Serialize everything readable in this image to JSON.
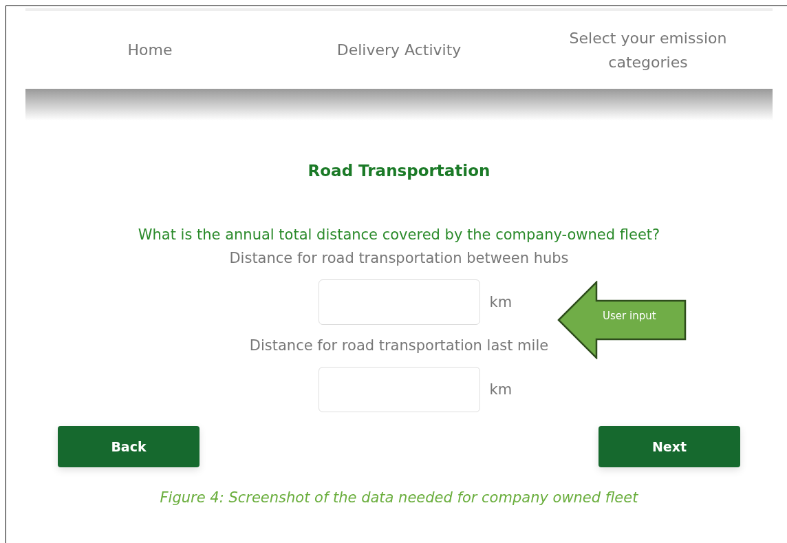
{
  "nav": {
    "items": [
      "Home",
      "Delivery Activity",
      "Select your emission categories"
    ]
  },
  "form": {
    "title": "Road Transportation",
    "question": "What is the annual total distance covered by the company-owned fleet?",
    "fields": [
      {
        "label": "Distance for road transportation between hubs",
        "unit": "km"
      },
      {
        "label": "Distance for road transportation last mile",
        "unit": "km"
      }
    ]
  },
  "callout": {
    "text": "User input"
  },
  "buttons": [
    "Back",
    "Next"
  ],
  "caption": "Figure 4: Screenshot of the data needed for company owned fleet"
}
